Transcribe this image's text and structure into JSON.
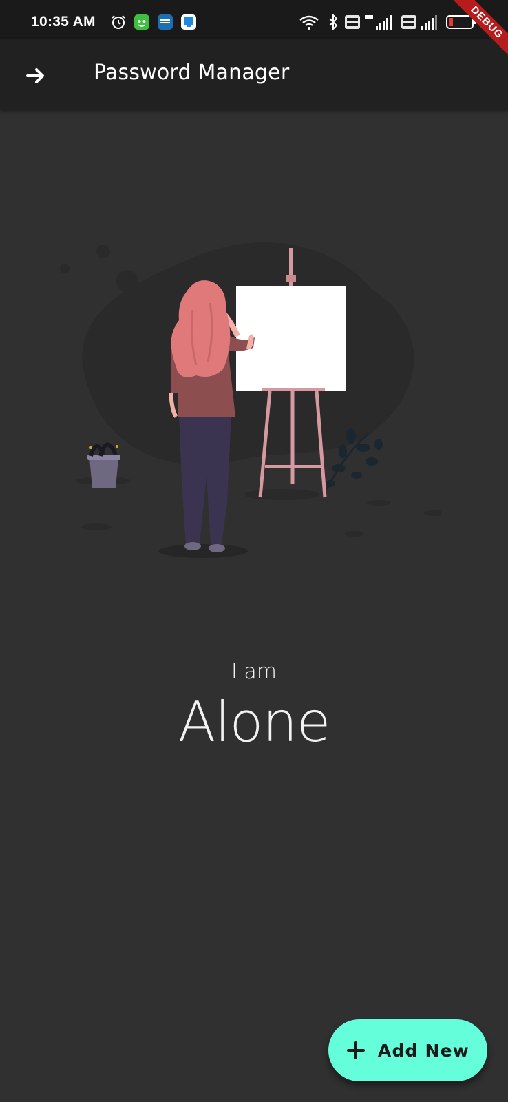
{
  "status_bar": {
    "time": "10:35 AM",
    "battery": "15",
    "debug_banner": "DEBUG",
    "icons": [
      "alarm-icon",
      "app-icon-green",
      "prime-video-icon",
      "app-icon-blue",
      "wifi-icon",
      "bluetooth-icon",
      "volte-icon",
      "signal-icon",
      "volte-icon",
      "signal-icon",
      "battery-icon"
    ]
  },
  "app_bar": {
    "title": "Password Manager",
    "leading_icon": "arrow-forward-icon"
  },
  "empty_state": {
    "line1": "I am",
    "line2": "Alone",
    "illustration": "woman-painting-easel"
  },
  "fab": {
    "label": "Add New",
    "icon": "plus-icon",
    "color": "#64ffda"
  },
  "colors": {
    "background": "#303030",
    "app_bar": "#212121",
    "status_bar": "#1a1a1a",
    "accent": "#64ffda"
  }
}
